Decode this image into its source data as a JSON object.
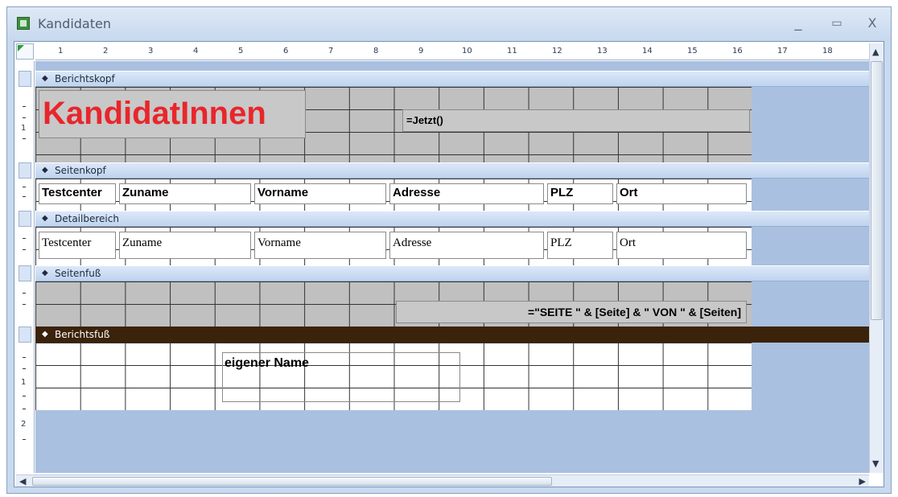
{
  "window": {
    "title": "Kandidaten",
    "controls": {
      "minimize": "_",
      "maximize": "▭",
      "close": "X"
    }
  },
  "ruler": {
    "top_numbers": [
      "1",
      "2",
      "3",
      "4",
      "5",
      "6",
      "7",
      "8",
      "9",
      "10",
      "11",
      "12",
      "13",
      "14",
      "15",
      "16",
      "17",
      "18"
    ],
    "left_numbers": [
      "1",
      "2"
    ]
  },
  "sections": {
    "report_header": {
      "label": "Berichtskopf",
      "title": "KandidatInnen",
      "now_expr": "=Jetzt()"
    },
    "page_header": {
      "label": "Seitenkopf",
      "fields": [
        "Testcenter",
        "Zuname",
        "Vorname",
        "Adresse",
        "PLZ",
        "Ort"
      ]
    },
    "detail": {
      "label": "Detailbereich",
      "fields": [
        "Testcenter",
        "Zuname",
        "Vorname",
        "Adresse",
        "PLZ",
        "Ort"
      ]
    },
    "page_footer": {
      "label": "Seitenfuß",
      "page_expr": "=\"SEITE \" & [Seite] & \" VON \" & [Seiten]"
    },
    "report_footer": {
      "label": "Berichtsfuß",
      "own_name": "eigener Name"
    }
  },
  "scrollbar": {
    "grip": "|||"
  },
  "colors": {
    "selected_band": "#3b220a",
    "title_red": "#e8262b",
    "canvas": "#a9c0e0"
  }
}
